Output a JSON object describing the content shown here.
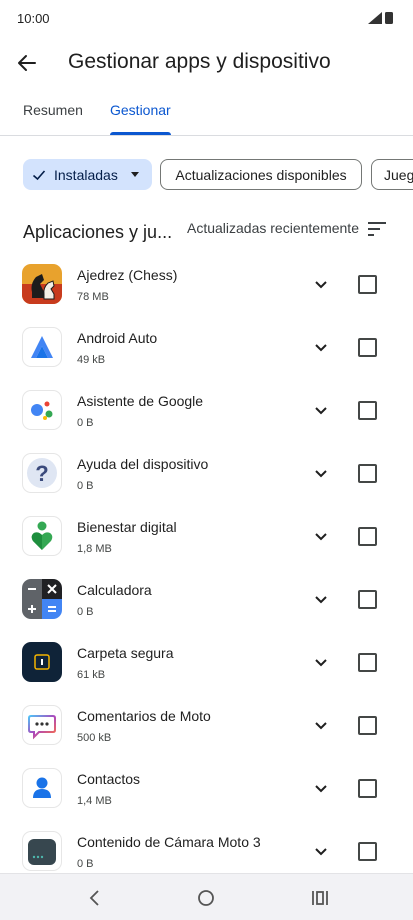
{
  "status": {
    "time": "10:00"
  },
  "header": {
    "title": "Gestionar apps y dispositivo"
  },
  "tabs": [
    {
      "label": "Resumen"
    },
    {
      "label": "Gestionar"
    }
  ],
  "filters": [
    {
      "label": "Instaladas",
      "selected": true
    },
    {
      "label": "Actualizaciones disponibles"
    },
    {
      "label": "Juegos"
    }
  ],
  "list": {
    "title": "Aplicaciones y ju...",
    "sort_label": "Actualizadas recientemente"
  },
  "apps": [
    {
      "name": "Ajedrez (Chess)",
      "size": "78 MB",
      "icon": "chess-icon"
    },
    {
      "name": "Android Auto",
      "size": "49 kB",
      "icon": "android-auto-icon"
    },
    {
      "name": "Asistente de Google",
      "size": "0 B",
      "icon": "google-assistant-icon"
    },
    {
      "name": "Ayuda del dispositivo",
      "size": "0 B",
      "icon": "question-mark-icon"
    },
    {
      "name": "Bienestar digital",
      "size": "1,8 MB",
      "icon": "digital-wellbeing-icon"
    },
    {
      "name": "Calculadora",
      "size": "0 B",
      "icon": "calculator-icon"
    },
    {
      "name": "Carpeta segura",
      "size": "61 kB",
      "icon": "secure-folder-icon"
    },
    {
      "name": "Comentarios de Moto",
      "size": "500 kB",
      "icon": "chat-bubble-icon"
    },
    {
      "name": "Contactos",
      "size": "1,4 MB",
      "icon": "contacts-icon"
    },
    {
      "name": "Contenido de Cámara Moto 3",
      "size": "0 B",
      "icon": "camera-content-icon"
    }
  ],
  "colors": {
    "accent": "#0b57d0",
    "chip_selected_bg": "#d3e3fd"
  }
}
